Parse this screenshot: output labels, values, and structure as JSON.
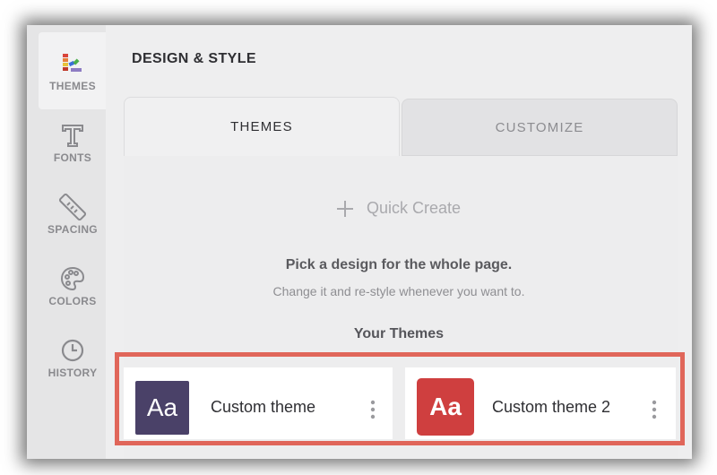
{
  "header": {
    "title": "DESIGN & STYLE"
  },
  "sidebar": {
    "items": [
      {
        "label": "THEMES",
        "icon": "palette-swatches-icon",
        "active": true
      },
      {
        "label": "FONTS",
        "icon": "font-icon",
        "active": false
      },
      {
        "label": "SPACING",
        "icon": "ruler-icon",
        "active": false
      },
      {
        "label": "COLORS",
        "icon": "paint-palette-icon",
        "active": false
      },
      {
        "label": "HISTORY",
        "icon": "clock-icon",
        "active": false
      }
    ]
  },
  "tabs": [
    {
      "label": "THEMES",
      "active": true
    },
    {
      "label": "CUSTOMIZE",
      "active": false
    }
  ],
  "quick_create": {
    "label": "Quick Create",
    "icon": "plus-icon"
  },
  "intro": {
    "heading": "Pick a design for the whole page.",
    "subtext": "Change it and re-style whenever you want to."
  },
  "your_themes": {
    "heading": "Your Themes",
    "items": [
      {
        "name": "Custom theme",
        "swatch_text": "Aa",
        "swatch_color": "#4a4168"
      },
      {
        "name": "Custom theme 2",
        "swatch_text": "Aa",
        "swatch_color": "#cf3f3f"
      }
    ]
  },
  "colors": {
    "highlight_border": "#e0665a"
  }
}
